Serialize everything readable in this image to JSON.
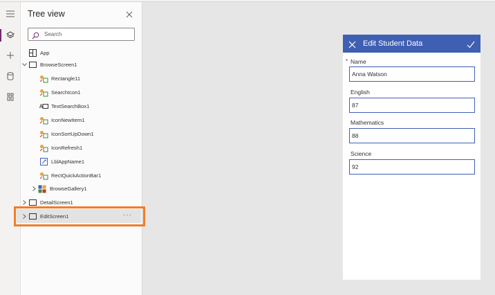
{
  "tree_panel": {
    "title": "Tree view",
    "search_placeholder": "Search",
    "app_label": "App",
    "nodes": [
      {
        "label": "BrowseScreen1"
      },
      {
        "label": "Rectangle11"
      },
      {
        "label": "SearchIcon1"
      },
      {
        "label": "TextSearchBox1"
      },
      {
        "label": "IconNewItem1"
      },
      {
        "label": "IconSortUpDown1"
      },
      {
        "label": "IconRefresh1"
      },
      {
        "label": "LblAppName1"
      },
      {
        "label": "RectQuickActionBar1"
      },
      {
        "label": "BrowseGallery1"
      },
      {
        "label": "DetailScreen1"
      },
      {
        "label": "EditScreen1"
      }
    ],
    "more_label": "···"
  },
  "form": {
    "title": "Edit Student Data",
    "fields": [
      {
        "label": "Name",
        "value": "Anna Watson",
        "required": "*"
      },
      {
        "label": "English",
        "value": "87"
      },
      {
        "label": "Mathematics",
        "value": "88"
      },
      {
        "label": "Science",
        "value": "92"
      }
    ]
  },
  "colors": {
    "accent": "#742774",
    "form_header": "#3f5fb3",
    "highlight": "#f37d23"
  }
}
